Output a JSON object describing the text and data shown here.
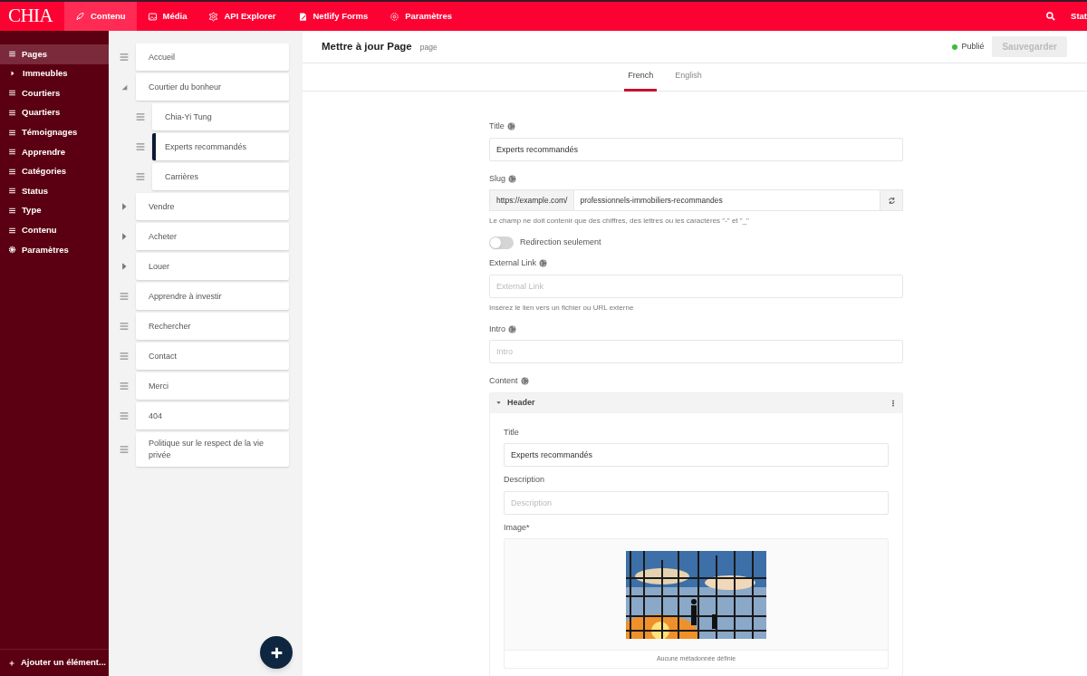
{
  "topbar": {
    "logo": "CHIA",
    "nav": [
      {
        "label": "Contenu",
        "selected": true
      },
      {
        "label": "Média",
        "selected": false
      },
      {
        "label": "API Explorer",
        "selected": false
      },
      {
        "label": "Netlify Forms",
        "selected": false
      },
      {
        "label": "Paramètres",
        "selected": false
      }
    ],
    "right_label": "Stat"
  },
  "sidebar": {
    "items": [
      {
        "label": "Pages",
        "kind": "list",
        "selected": true
      },
      {
        "label": "Immeubles",
        "kind": "arrow",
        "selected": false
      },
      {
        "label": "Courtiers",
        "kind": "list",
        "selected": false
      },
      {
        "label": "Quartiers",
        "kind": "list",
        "selected": false
      },
      {
        "label": "Témoignages",
        "kind": "list",
        "selected": false
      },
      {
        "label": "Apprendre",
        "kind": "list",
        "selected": false
      },
      {
        "label": "Catégories",
        "kind": "list",
        "selected": false
      },
      {
        "label": "Status",
        "kind": "list",
        "selected": false
      },
      {
        "label": "Type",
        "kind": "list",
        "selected": false
      },
      {
        "label": "Contenu",
        "kind": "list",
        "selected": false
      },
      {
        "label": "Paramètres",
        "kind": "gear",
        "selected": false
      }
    ],
    "add_label": "Ajouter un élément..."
  },
  "tree": [
    {
      "label": "Accueil",
      "kind": "drag",
      "selected": false
    },
    {
      "label": "Courtier du bonheur",
      "kind": "expanded",
      "selected": false,
      "children": [
        {
          "label": "Chia-Yi Tung",
          "kind": "drag",
          "selected": false
        },
        {
          "label": "Experts recommandés",
          "kind": "drag",
          "selected": true
        },
        {
          "label": "Carrières",
          "kind": "drag",
          "selected": false
        }
      ]
    },
    {
      "label": "Vendre",
      "kind": "collapsed",
      "selected": false
    },
    {
      "label": "Acheter",
      "kind": "collapsed",
      "selected": false
    },
    {
      "label": "Louer",
      "kind": "collapsed",
      "selected": false
    },
    {
      "label": "Apprendre à investir",
      "kind": "drag",
      "selected": false
    },
    {
      "label": "Rechercher",
      "kind": "drag",
      "selected": false
    },
    {
      "label": "Contact",
      "kind": "drag",
      "selected": false
    },
    {
      "label": "Merci",
      "kind": "drag",
      "selected": false
    },
    {
      "label": "404",
      "kind": "drag",
      "selected": false
    },
    {
      "label": "Politique sur le respect de la vie privée",
      "kind": "drag",
      "selected": false
    }
  ],
  "header": {
    "title": "Mettre à jour Page",
    "subtitle": "page",
    "status": {
      "label": "Publié",
      "color": "#3bbf3b"
    },
    "save_label": "Sauvegarder",
    "save_disabled": true
  },
  "lang_tabs": [
    {
      "label": "French",
      "selected": true
    },
    {
      "label": "English",
      "selected": false
    }
  ],
  "form": {
    "title": {
      "label": "Title",
      "value": "Experts recommandés"
    },
    "slug": {
      "label": "Slug",
      "prefix": "https://example.com/",
      "value": "professionnels-immobiliers-recommandes",
      "help": "Le champ ne doit contenir que des chiffres, des lettres ou les caractères \"-\" et \"_\""
    },
    "redirect": {
      "label": "Redirection seulement",
      "on": false
    },
    "external": {
      "label": "External Link",
      "placeholder": "External Link",
      "help": "Insérez le lien vers un fichier ou URL externe"
    },
    "intro": {
      "label": "Intro",
      "placeholder": "Intro"
    },
    "content": {
      "label": "Content",
      "block": {
        "title": "Header",
        "expanded": true,
        "fields": [
          {
            "label": "Title",
            "value": "Experts recommandés"
          },
          {
            "label": "Description",
            "placeholder": "Description"
          }
        ],
        "image": {
          "label": "Image*",
          "caption": "Aucune métadonnée définie"
        }
      }
    }
  }
}
